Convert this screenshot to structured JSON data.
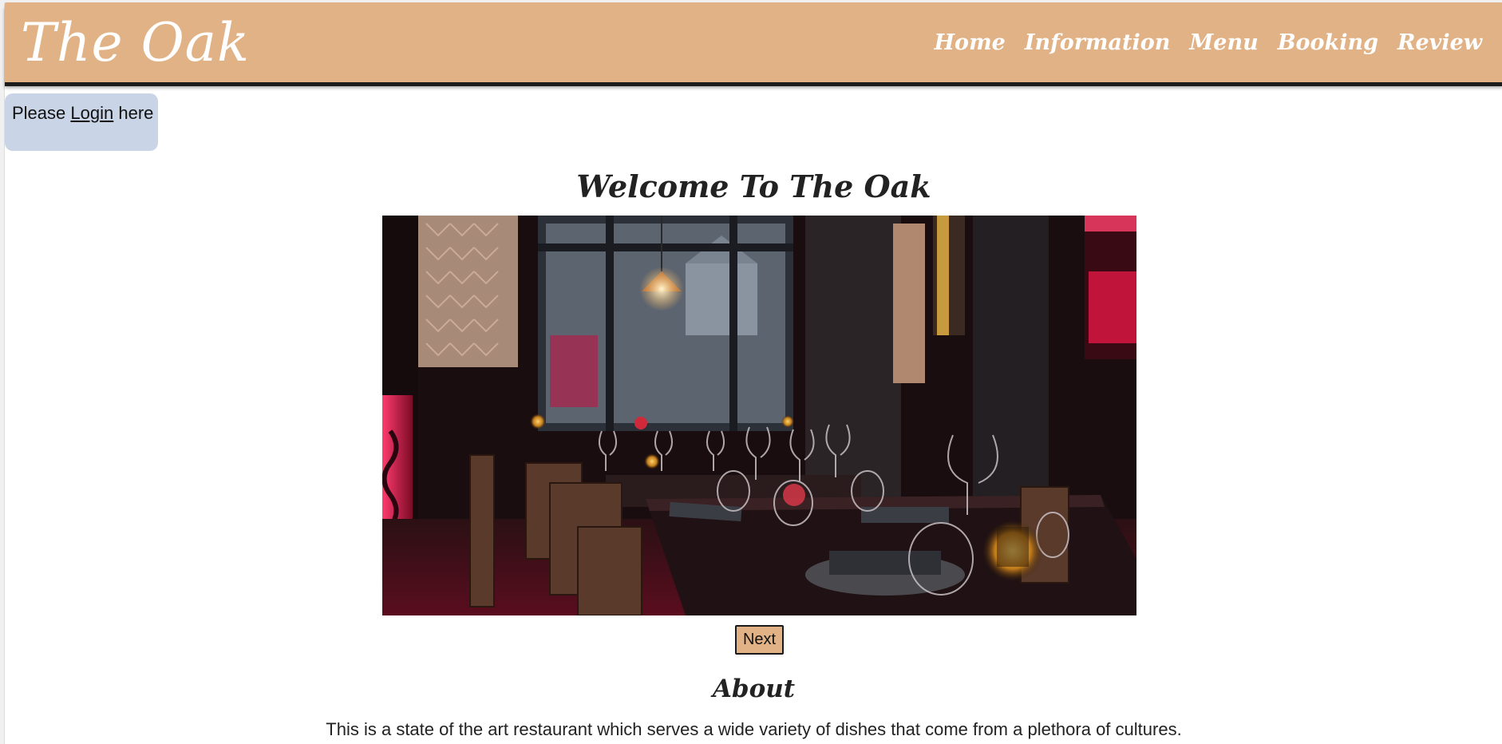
{
  "brand": {
    "title": "The Oak"
  },
  "nav": {
    "items": [
      {
        "label": "Home"
      },
      {
        "label": "Information"
      },
      {
        "label": "Menu"
      },
      {
        "label": "Booking"
      },
      {
        "label": "Review"
      }
    ]
  },
  "login": {
    "prefix": "Please",
    "link_label": "Login",
    "suffix": "here"
  },
  "main": {
    "welcome_heading": "Welcome To The Oak",
    "next_label": "Next"
  },
  "about": {
    "heading": "About",
    "text": "This is a state of the art restaurant which serves a wide variety of dishes that come from a plethora of cultures."
  },
  "colors": {
    "nav_bg": "#e0b285",
    "login_bg": "#c9d5e6",
    "button_bg": "#e0b285",
    "text": "#222222"
  }
}
